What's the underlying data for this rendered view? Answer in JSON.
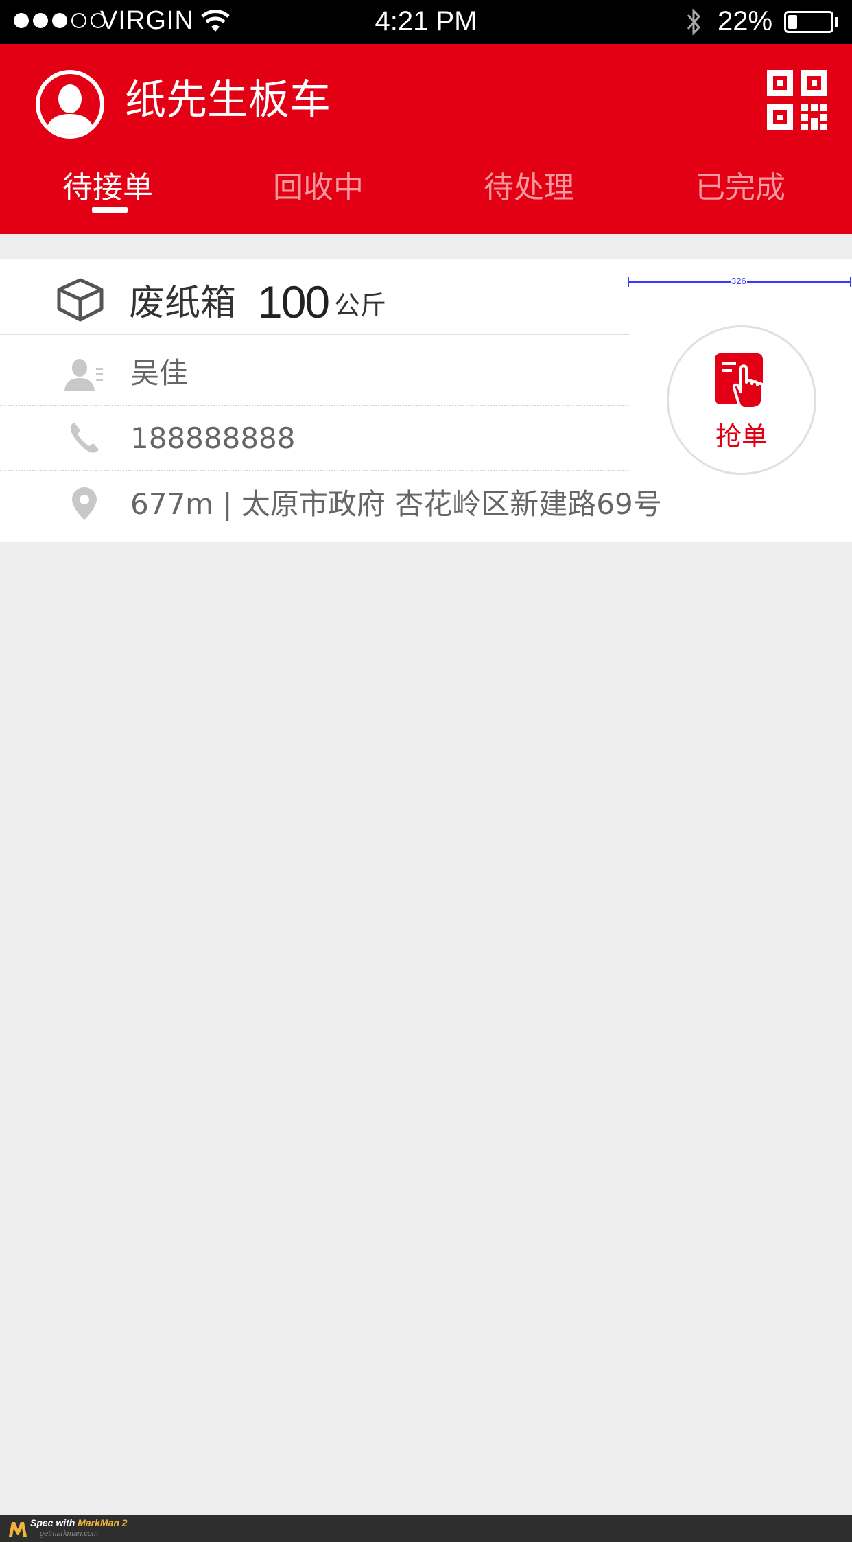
{
  "status_bar": {
    "signal_full": 3,
    "signal_empty": 2,
    "carrier": "VIRGIN",
    "time": "4:21 PM",
    "battery_text": "22%",
    "battery_level": 0.22
  },
  "header": {
    "title": "纸先生板车",
    "tabs": [
      {
        "label": "待接单",
        "active": true
      },
      {
        "label": "回收中",
        "active": false
      },
      {
        "label": "待处理",
        "active": false
      },
      {
        "label": "已完成",
        "active": false
      }
    ]
  },
  "order": {
    "material": "废纸箱",
    "weight": "100",
    "unit": "公斤",
    "contact_name": "吴佳",
    "phone": "188888888",
    "address": "677m | 太原市政府 杏花岭区新建路69号",
    "grab_label": "抢单"
  },
  "annotation": {
    "measure_label": "326"
  },
  "footer": {
    "spec_prefix": "Spec with ",
    "brand": "MarkMan 2",
    "site": "getmarkman.com"
  },
  "colors": {
    "brand_red": "#e30015",
    "tab_inactive": "#f4999f",
    "background": "#ededed"
  }
}
